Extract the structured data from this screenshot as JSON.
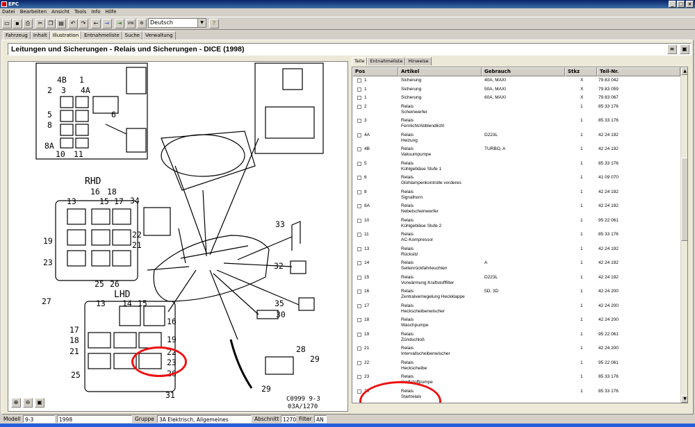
{
  "app": {
    "title": "EPC"
  },
  "menu": [
    "Datei",
    "Bearbeiten",
    "Ansicht",
    "Tools",
    "Info",
    "Hilfe"
  ],
  "toolbar": {
    "vin_label": "VIN",
    "lang_value": "Deutsch"
  },
  "tabs": [
    "Fahrzeug",
    "Inhalt",
    "Illustration",
    "Entnahmeliste",
    "Suche",
    "Verwaltung"
  ],
  "active_tab": "Illustration",
  "header": {
    "title": "Leitungen und Sicherungen - Relais und Sicherungen - DICE    (1998)"
  },
  "diagram": {
    "labels": [
      "1",
      "2",
      "3",
      "4B",
      "4A",
      "5",
      "6",
      "8",
      "8A",
      "10",
      "11",
      "RHD",
      "16",
      "18",
      "13",
      "15",
      "17",
      "34",
      "19",
      "22",
      "21",
      "23",
      "25",
      "26",
      "33",
      "32",
      "35",
      "30",
      "LHD",
      "27",
      "14",
      "28",
      "29",
      "31"
    ],
    "caption1": "C0999 9-3",
    "caption2": "03A/1270"
  },
  "right_tabs": [
    "Teile",
    "Entnahmeliste",
    "Hinweise"
  ],
  "table": {
    "headers": [
      "Pos",
      "Artikel",
      "Gebrauch",
      "Stkz",
      "Teil-Nr."
    ],
    "rows": [
      {
        "pos": "1",
        "art": "Sicherung",
        "art2": "",
        "gb": "40A, MAXI",
        "st": "X",
        "tn": "79 83 042"
      },
      {
        "pos": "1",
        "art": "Sicherung",
        "art2": "",
        "gb": "50A, MAXI",
        "st": "X",
        "tn": "79 83 059"
      },
      {
        "pos": "1",
        "art": "Sicherung",
        "art2": "",
        "gb": "60A, MAXI",
        "st": "X",
        "tn": "79 83 067"
      },
      {
        "pos": "2",
        "art": "Relais",
        "art2": "Scheinwerfer",
        "gb": "",
        "st": "1",
        "tn": "85 33 176"
      },
      {
        "pos": "3",
        "art": "Relais",
        "art2": "Fernlicht/Abblendlicht",
        "gb": "",
        "st": "1",
        "tn": "85 33 176"
      },
      {
        "pos": "4A",
        "art": "Relais",
        "art2": "Heizung",
        "gb": "D223L",
        "st": "1",
        "tn": "42 24 192"
      },
      {
        "pos": "4B",
        "art": "Relais",
        "art2": "Vakuumpumpe",
        "gb": "TURBO, A",
        "st": "1",
        "tn": "42 24 192"
      },
      {
        "pos": "5",
        "art": "Relais",
        "art2": "Kühlgebläse Stufe 1",
        "gb": "",
        "st": "1",
        "tn": "85 33 176"
      },
      {
        "pos": "6",
        "art": "Relais",
        "art2": "Glühlampenkontrolle vorderes",
        "gb": "",
        "st": "1",
        "tn": "41 09 070"
      },
      {
        "pos": "8",
        "art": "Relais",
        "art2": "Signalhorn",
        "gb": "",
        "st": "1",
        "tn": "42 24 192"
      },
      {
        "pos": "8A",
        "art": "Relais",
        "art2": "Nebelscheinwerfer",
        "gb": "",
        "st": "1",
        "tn": "42 24 192"
      },
      {
        "pos": "10",
        "art": "Relais",
        "art2": "Kühlgebläse Stufe 2",
        "gb": "",
        "st": "1",
        "tn": "95 22 061"
      },
      {
        "pos": "11",
        "art": "Relais",
        "art2": "AC-Kompressor",
        "gb": "",
        "st": "1",
        "tn": "85 33 176"
      },
      {
        "pos": "13",
        "art": "Relais",
        "art2": "Rücksitz",
        "gb": "",
        "st": "1",
        "tn": "42 24 192"
      },
      {
        "pos": "14",
        "art": "Relais",
        "art2": "Seitenrückfahrleuchten",
        "gb": "A",
        "st": "1",
        "tn": "42 24 192"
      },
      {
        "pos": "15",
        "art": "Relais",
        "art2": "Vorwärmung Kraftstofffilter",
        "gb": "D223L",
        "st": "1",
        "tn": "42 24 192"
      },
      {
        "pos": "16",
        "art": "Relais",
        "art2": "Zentralverriegelung Heckklappe",
        "gb": "5D, 3D",
        "st": "1",
        "tn": "42 24 200"
      },
      {
        "pos": "17",
        "art": "Relais",
        "art2": "Heckscheibenwischer",
        "gb": "",
        "st": "1",
        "tn": "42 24 200"
      },
      {
        "pos": "18",
        "art": "Relais",
        "art2": "Waschpumpe",
        "gb": "",
        "st": "1",
        "tn": "42 24 200"
      },
      {
        "pos": "19",
        "art": "Relais",
        "art2": "Zündschloß",
        "gb": "",
        "st": "1",
        "tn": "95 22 061"
      },
      {
        "pos": "21",
        "art": "Relais",
        "art2": "Intervallscheibenwischer",
        "gb": "",
        "st": "1",
        "tn": "42 24 200"
      },
      {
        "pos": "22",
        "art": "Relais",
        "art2": "Heckscheibe",
        "gb": "",
        "st": "1",
        "tn": "95 22 061"
      },
      {
        "pos": "23",
        "art": "Relais",
        "art2": "Kraftstoffpumpe",
        "gb": "",
        "st": "1",
        "tn": "85 33 176"
      },
      {
        "pos": "25",
        "art": "Relais",
        "art2": "Startrelais",
        "gb": "",
        "st": "1",
        "tn": "85 33 176"
      }
    ]
  },
  "status": {
    "modell_label": "Modell",
    "modell": "9-3",
    "year": "1998",
    "gruppe_label": "Gruppe",
    "gruppe": "3A Elektrisch, Allgemeines",
    "abschnitt_label": "Abschnitt",
    "abschnitt": "1270",
    "filter_label": "Filter",
    "filter": "AN"
  },
  "colors": {
    "titlebar": "#0a246a",
    "highlight_ring": "#e11111",
    "window_bg": "#d4d0c8"
  }
}
